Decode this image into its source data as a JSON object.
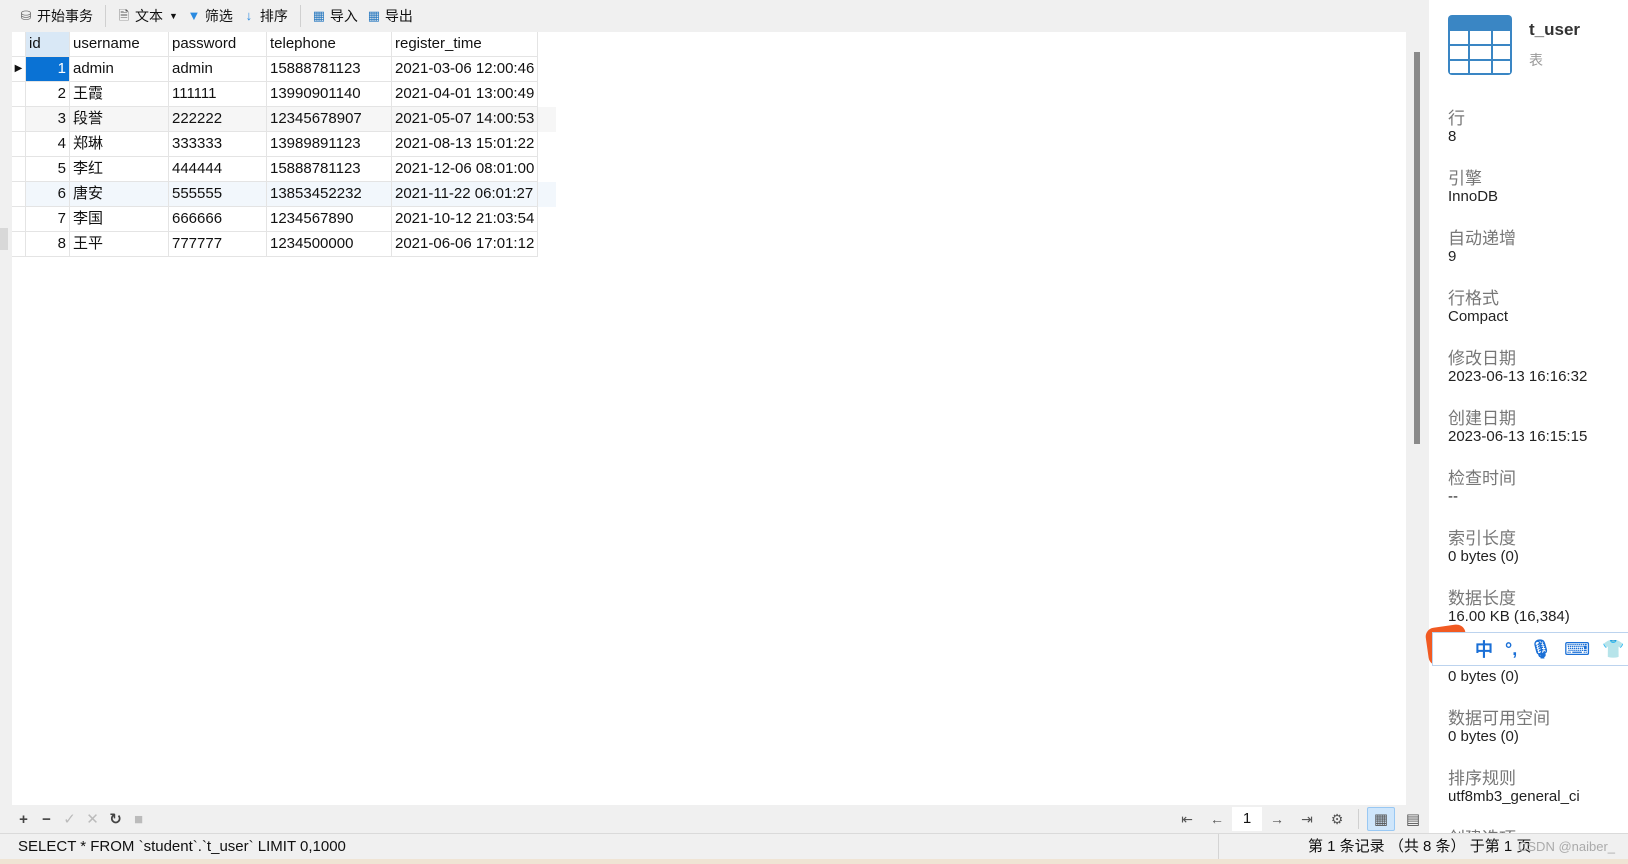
{
  "toolbar": {
    "begin_transaction": "开始事务",
    "text": "文本",
    "filter": "筛选",
    "sort": "排序",
    "import": "导入",
    "export": "导出"
  },
  "grid": {
    "columns": [
      "id",
      "username",
      "password",
      "telephone",
      "register_time"
    ],
    "rows": [
      [
        "1",
        "admin",
        "admin",
        "15888781123",
        "2021-03-06 12:00:46"
      ],
      [
        "2",
        "王霞",
        "111111",
        "13990901140",
        "2021-04-01 13:00:49"
      ],
      [
        "3",
        "段誉",
        "222222",
        "12345678907",
        "2021-05-07 14:00:53"
      ],
      [
        "4",
        "郑琳",
        "333333",
        "13989891123",
        "2021-08-13 15:01:22"
      ],
      [
        "5",
        "李红",
        "444444",
        "15888781123",
        "2021-12-06 08:01:00"
      ],
      [
        "6",
        "唐安",
        "555555",
        "13853452232",
        "2021-11-22 06:01:27"
      ],
      [
        "7",
        "李国",
        "666666",
        "1234567890",
        "2021-10-12 21:03:54"
      ],
      [
        "8",
        "王平",
        "777777",
        "1234500000",
        "2021-06-06 17:01:12"
      ]
    ]
  },
  "pager": {
    "page": "1"
  },
  "status": {
    "sql": "SELECT * FROM `student`.`t_user` LIMIT 0,1000",
    "record": "第 1 条记录 （共 8 条） 于第 1 页",
    "watermark": "CSDN @naiber_"
  },
  "panel": {
    "title": "t_user",
    "subtitle": "表",
    "props": [
      {
        "label": "行",
        "value": "8"
      },
      {
        "label": "引擎",
        "value": "InnoDB"
      },
      {
        "label": "自动递增",
        "value": "9"
      },
      {
        "label": "行格式",
        "value": "Compact"
      },
      {
        "label": "修改日期",
        "value": "2023-06-13 16:16:32"
      },
      {
        "label": "创建日期",
        "value": "2023-06-13 16:15:15"
      },
      {
        "label": "检查时间",
        "value": "--"
      },
      {
        "label": "索引长度",
        "value": "0 bytes (0)"
      },
      {
        "label": "数据长度",
        "value": "16.00 KB (16,384)"
      },
      {
        "label": "",
        "value": "0 bytes (0)"
      },
      {
        "label": "数据可用空间",
        "value": "0 bytes (0)"
      },
      {
        "label": "排序规则",
        "value": "utf8mb3_general_ci"
      },
      {
        "label": "创建选项",
        "value": ""
      }
    ]
  },
  "ime": {
    "logo": "S",
    "mode": "中",
    "punct": "°,"
  },
  "colors": {
    "selection": "#0a72d4",
    "header_id": "#d9e8f6",
    "ime": "#1a6fd6",
    "ime_logo": "#f15a22"
  }
}
